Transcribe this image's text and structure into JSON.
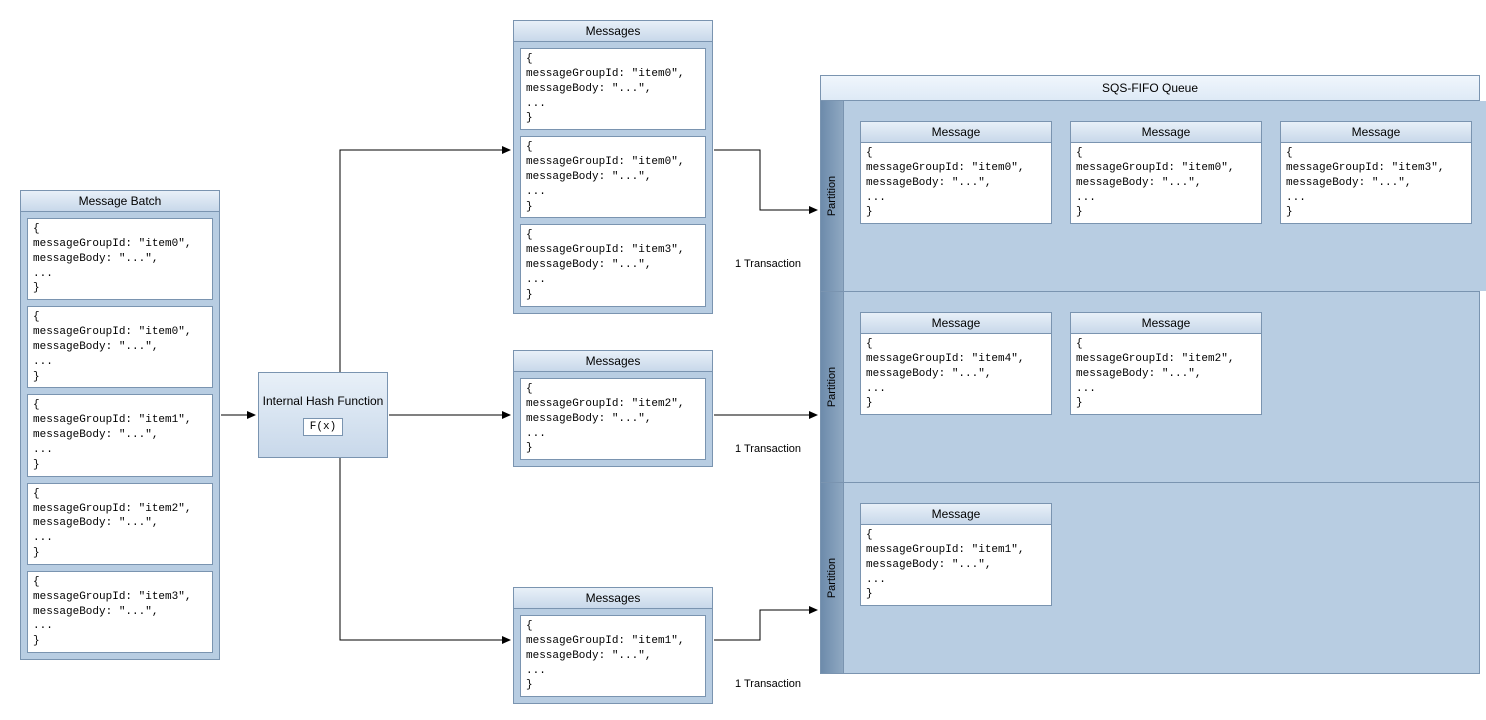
{
  "messageBatch": {
    "title": "Message Batch",
    "items": [
      "{\nmessageGroupId: \"item0\",\nmessageBody: \"...\",\n...\n}",
      "{\nmessageGroupId: \"item0\",\nmessageBody: \"...\",\n...\n}",
      "{\nmessageGroupId: \"item1\",\nmessageBody: \"...\",\n...\n}",
      "{\nmessageGroupId: \"item2\",\nmessageBody: \"...\",\n...\n}",
      "{\nmessageGroupId: \"item3\",\nmessageBody: \"...\",\n...\n}"
    ]
  },
  "hashFunction": {
    "label": "Internal Hash Function",
    "fx": "F(x)"
  },
  "groups": [
    {
      "title": "Messages",
      "transactionLabel": "1 Transaction",
      "items": [
        "{\nmessageGroupId: \"item0\",\nmessageBody: \"...\",\n...\n}",
        "{\nmessageGroupId: \"item0\",\nmessageBody: \"...\",\n...\n}",
        "{\nmessageGroupId: \"item3\",\nmessageBody: \"...\",\n...\n}"
      ]
    },
    {
      "title": "Messages",
      "transactionLabel": "1 Transaction",
      "items": [
        "{\nmessageGroupId: \"item2\",\nmessageBody: \"...\",\n...\n}"
      ]
    },
    {
      "title": "Messages",
      "transactionLabel": "1 Transaction",
      "items": [
        "{\nmessageGroupId: \"item1\",\nmessageBody: \"...\",\n...\n}"
      ]
    }
  ],
  "queue": {
    "title": "SQS-FIFO Queue",
    "partitionLabel": "Partition",
    "messageLabel": "Message",
    "partitions": [
      [
        "{\nmessageGroupId: \"item0\",\nmessageBody: \"...\",\n...\n}",
        "{\nmessageGroupId: \"item0\",\nmessageBody: \"...\",\n...\n}",
        "{\nmessageGroupId: \"item3\",\nmessageBody: \"...\",\n...\n}"
      ],
      [
        "{\nmessageGroupId: \"item4\",\nmessageBody: \"...\",\n...\n}",
        "{\nmessageGroupId: \"item2\",\nmessageBody: \"...\",\n...\n}"
      ],
      [
        "{\nmessageGroupId: \"item1\",\nmessageBody: \"...\",\n...\n}"
      ]
    ]
  }
}
